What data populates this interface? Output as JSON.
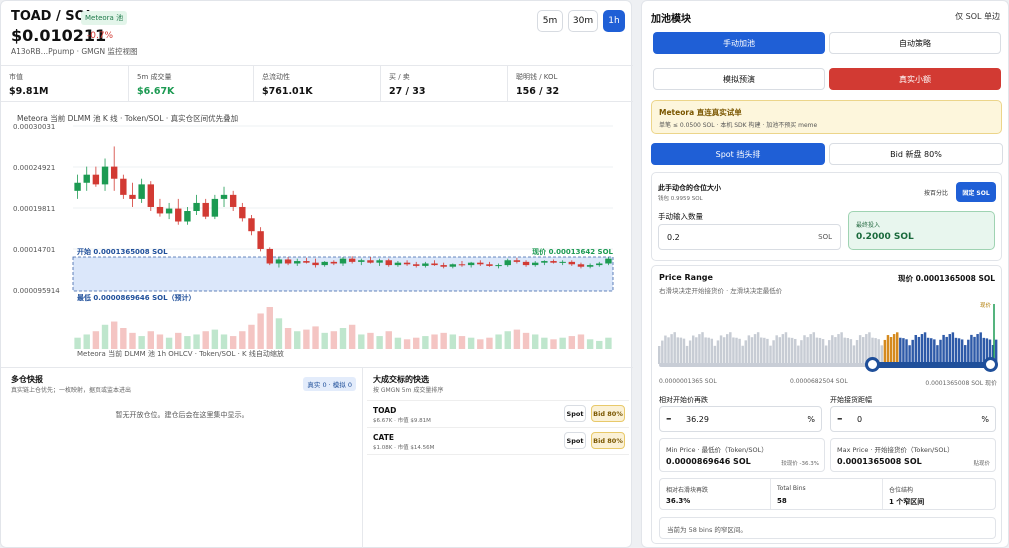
{
  "header": {
    "symbol": "TOAD / SOL",
    "badge": "Meteora 池",
    "price": "$0.010211",
    "change": "-0.7%",
    "address": "A13oRB…Ppump · GMGN 监控视图"
  },
  "timeframes": [
    "5m",
    "30m",
    "1h"
  ],
  "stats": [
    {
      "label": "市值",
      "value": "$9.81M"
    },
    {
      "label": "5m 成交量",
      "value": "$6.67K"
    },
    {
      "label": "总流动性",
      "value": "$761.01K"
    },
    {
      "label": "买 / 卖",
      "value": "27 / 33"
    },
    {
      "label": "聪明钱 / KOL",
      "value": "156 / 32"
    }
  ],
  "chart": {
    "title": "Meteora 当前 DLMM 池 K 线 · Token/SOL · 真实仓区间优先叠加",
    "yticks": [
      "0.00030031",
      "0.00024921",
      "0.00019811",
      "0.00014701",
      "0.000095914"
    ],
    "start_label": "开始 0.0001365008 SOL",
    "current_label": "现价 0.00013642 SOL",
    "lowest_label": "最低 0.0000869646 SOL（预计）",
    "volume_label": "Meteora 当前 DLMM 池 1h OHLCV · Token/SOL · K 线自动缩放"
  },
  "chart_data": {
    "type": "candlestick",
    "title": "Meteora 当前 DLMM 池 K 线 · Token/SOL · 真实仓区间优先叠加",
    "y_range": [
      9.5914e-05,
      0.00030031
    ],
    "range_band": {
      "high": 0.0001365008,
      "low": 8.69646e-05
    },
    "candles": [
      {
        "o": 0.00022,
        "h": 0.00024,
        "l": 0.00021,
        "c": 0.00023,
        "v": 14
      },
      {
        "o": 0.00023,
        "h": 0.00025,
        "l": 0.00022,
        "c": 0.00024,
        "v": 18
      },
      {
        "o": 0.00024,
        "h": 0.00025,
        "l": 0.000225,
        "c": 0.000228,
        "v": 22
      },
      {
        "o": 0.000228,
        "h": 0.00026,
        "l": 0.00022,
        "c": 0.00025,
        "v": 30
      },
      {
        "o": 0.00025,
        "h": 0.000275,
        "l": 0.00022,
        "c": 0.000235,
        "v": 34
      },
      {
        "o": 0.000235,
        "h": 0.00024,
        "l": 0.00021,
        "c": 0.000215,
        "v": 26
      },
      {
        "o": 0.000215,
        "h": 0.00023,
        "l": 0.0002,
        "c": 0.00021,
        "v": 20
      },
      {
        "o": 0.00021,
        "h": 0.000235,
        "l": 0.000205,
        "c": 0.000228,
        "v": 16
      },
      {
        "o": 0.000228,
        "h": 0.000232,
        "l": 0.000195,
        "c": 0.0002,
        "v": 22
      },
      {
        "o": 0.0002,
        "h": 0.00021,
        "l": 0.000188,
        "c": 0.000192,
        "v": 18
      },
      {
        "o": 0.000192,
        "h": 0.000205,
        "l": 0.000185,
        "c": 0.000198,
        "v": 14
      },
      {
        "o": 0.000198,
        "h": 0.00021,
        "l": 0.000178,
        "c": 0.000182,
        "v": 20
      },
      {
        "o": 0.000182,
        "h": 0.0002,
        "l": 0.000178,
        "c": 0.000195,
        "v": 16
      },
      {
        "o": 0.000195,
        "h": 0.000215,
        "l": 0.00019,
        "c": 0.000205,
        "v": 18
      },
      {
        "o": 0.000205,
        "h": 0.00021,
        "l": 0.000185,
        "c": 0.000188,
        "v": 22
      },
      {
        "o": 0.000188,
        "h": 0.000215,
        "l": 0.000185,
        "c": 0.00021,
        "v": 24
      },
      {
        "o": 0.00021,
        "h": 0.000225,
        "l": 0.0002,
        "c": 0.000215,
        "v": 18
      },
      {
        "o": 0.000215,
        "h": 0.00022,
        "l": 0.000195,
        "c": 0.0002,
        "v": 16
      },
      {
        "o": 0.0002,
        "h": 0.000205,
        "l": 0.000182,
        "c": 0.000186,
        "v": 22
      },
      {
        "o": 0.000186,
        "h": 0.00019,
        "l": 0.000165,
        "c": 0.00017,
        "v": 30
      },
      {
        "o": 0.00017,
        "h": 0.000175,
        "l": 0.000145,
        "c": 0.000148,
        "v": 44
      },
      {
        "o": 0.000148,
        "h": 0.00015,
        "l": 0.000128,
        "c": 0.00013,
        "v": 52
      },
      {
        "o": 0.00013,
        "h": 0.000138,
        "l": 0.000125,
        "c": 0.000135,
        "v": 38
      },
      {
        "o": 0.000135,
        "h": 0.000138,
        "l": 0.000128,
        "c": 0.00013,
        "v": 26
      },
      {
        "o": 0.00013,
        "h": 0.000136,
        "l": 0.000127,
        "c": 0.000133,
        "v": 22
      },
      {
        "o": 0.000133,
        "h": 0.000137,
        "l": 0.00013,
        "c": 0.000131,
        "v": 24
      },
      {
        "o": 0.000131,
        "h": 0.000136,
        "l": 0.000125,
        "c": 0.000128,
        "v": 28
      },
      {
        "o": 0.000128,
        "h": 0.000133,
        "l": 0.000126,
        "c": 0.000132,
        "v": 20
      },
      {
        "o": 0.000132,
        "h": 0.000134,
        "l": 0.000128,
        "c": 0.00013,
        "v": 22
      },
      {
        "o": 0.00013,
        "h": 0.000138,
        "l": 0.000127,
        "c": 0.000136,
        "v": 26
      },
      {
        "o": 0.000136,
        "h": 0.000139,
        "l": 0.00013,
        "c": 0.000132,
        "v": 30
      },
      {
        "o": 0.000132,
        "h": 0.000136,
        "l": 0.000128,
        "c": 0.000134,
        "v": 18
      },
      {
        "o": 0.000134,
        "h": 0.000138,
        "l": 0.00013,
        "c": 0.000131,
        "v": 20
      },
      {
        "o": 0.000131,
        "h": 0.000136,
        "l": 0.000127,
        "c": 0.000134,
        "v": 16
      },
      {
        "o": 0.000134,
        "h": 0.000136,
        "l": 0.000126,
        "c": 0.000128,
        "v": 22
      },
      {
        "o": 0.000128,
        "h": 0.000133,
        "l": 0.000126,
        "c": 0.000131,
        "v": 14
      },
      {
        "o": 0.000131,
        "h": 0.000134,
        "l": 0.000127,
        "c": 0.000129,
        "v": 12
      },
      {
        "o": 0.000129,
        "h": 0.000132,
        "l": 0.000125,
        "c": 0.000127,
        "v": 14
      },
      {
        "o": 0.000127,
        "h": 0.000132,
        "l": 0.000125,
        "c": 0.00013,
        "v": 16
      },
      {
        "o": 0.00013,
        "h": 0.000134,
        "l": 0.000127,
        "c": 0.000128,
        "v": 18
      },
      {
        "o": 0.000128,
        "h": 0.000131,
        "l": 0.000124,
        "c": 0.000126,
        "v": 20
      },
      {
        "o": 0.000126,
        "h": 0.00013,
        "l": 0.000124,
        "c": 0.000129,
        "v": 18
      },
      {
        "o": 0.000129,
        "h": 0.000133,
        "l": 0.000126,
        "c": 0.000128,
        "v": 16
      },
      {
        "o": 0.000128,
        "h": 0.000132,
        "l": 0.000125,
        "c": 0.000131,
        "v": 14
      },
      {
        "o": 0.000131,
        "h": 0.000134,
        "l": 0.000127,
        "c": 0.000129,
        "v": 12
      },
      {
        "o": 0.000129,
        "h": 0.000132,
        "l": 0.000126,
        "c": 0.000127,
        "v": 14
      },
      {
        "o": 0.000127,
        "h": 0.00013,
        "l": 0.000124,
        "c": 0.000128,
        "v": 18
      },
      {
        "o": 0.000128,
        "h": 0.000136,
        "l": 0.000126,
        "c": 0.000134,
        "v": 22
      },
      {
        "o": 0.000134,
        "h": 0.000137,
        "l": 0.00013,
        "c": 0.000132,
        "v": 24
      },
      {
        "o": 0.000132,
        "h": 0.000134,
        "l": 0.000126,
        "c": 0.000128,
        "v": 20
      },
      {
        "o": 0.000128,
        "h": 0.000133,
        "l": 0.000126,
        "c": 0.000131,
        "v": 18
      },
      {
        "o": 0.000131,
        "h": 0.000134,
        "l": 0.000128,
        "c": 0.000133,
        "v": 14
      },
      {
        "o": 0.000133,
        "h": 0.000135,
        "l": 0.00013,
        "c": 0.000131,
        "v": 12
      },
      {
        "o": 0.000131,
        "h": 0.000134,
        "l": 0.000128,
        "c": 0.000132,
        "v": 14
      },
      {
        "o": 0.000132,
        "h": 0.000134,
        "l": 0.000127,
        "c": 0.000129,
        "v": 16
      },
      {
        "o": 0.000129,
        "h": 0.000131,
        "l": 0.000124,
        "c": 0.000126,
        "v": 18
      },
      {
        "o": 0.000126,
        "h": 0.00013,
        "l": 0.000124,
        "c": 0.000128,
        "v": 12
      },
      {
        "o": 0.000128,
        "h": 0.000132,
        "l": 0.000126,
        "c": 0.00013,
        "v": 10
      },
      {
        "o": 0.00013,
        "h": 0.000138,
        "l": 0.000128,
        "c": 0.000136,
        "v": 14
      }
    ]
  },
  "multi_snapshot": {
    "title": "多仓快报",
    "subtitle": "真实链上仓优先；一枚映射，据页或监本进出",
    "tag": "真实 0 · 模拟 0",
    "empty": "暂无开放仓位。建仓后会在这里集中显示。"
  },
  "big_trade": {
    "title": "大成交标的快选",
    "subtitle": "按 GMGN 5m 成交量排序",
    "items": [
      {
        "name": "TOAD",
        "detail": "$6.67K · 市值 $9.81M",
        "spot": "Spot",
        "bid": "Bid 80%"
      },
      {
        "name": "CATE",
        "detail": "$1.08K · 市值 $14.56M",
        "spot": "Spot",
        "bid": "Bid 80%"
      }
    ]
  },
  "right": {
    "title": "加池模块",
    "title_right": "仅 SOL 单边",
    "mode_manual": "手动加池",
    "mode_auto": "自动策略",
    "sim": "模拟预演",
    "real": "真实小额",
    "notice_title": "Meteora 直连真实试单",
    "notice_body": "单笔 ≤ 0.0500 SOL · 本机 SDK 构建 · 加池不预买 meme",
    "spot": "Spot 挡头排",
    "bid": "Bid 新盘 80%",
    "size_title": "此手动仓的仓位大小",
    "size_sub": "钱包 0.9959 SOL",
    "by_pct": "按百分比",
    "fixed": "固定 SOL",
    "input_label": "手动输入数量",
    "input_value": "0.2",
    "input_unit": "SOL",
    "final_label": "最终投入",
    "final_value": "0.2000 SOL",
    "pr_title": "Price Range",
    "pr_desc": "右滑块决定开始接货价 · 左滑块决定最低价",
    "pr_cur": "现价 0.0001365008 SOL",
    "pr_now": "现价",
    "axis_left": "0.0000001365 SOL",
    "axis_mid": "0.0000682504 SOL",
    "axis_right": "0.0001365008 SOL 现价",
    "rel_label": "相对开始价再跌",
    "rel_value": "36.29",
    "rel_unit": "%",
    "start_label": "开始接货距幅",
    "start_value": "0",
    "start_unit": "%",
    "min_title": "Min Price · 最低价（Token/SOL）",
    "min_value": "0.0000869646 SOL",
    "min_note": "较现价 -36.3%",
    "max_title": "Max Price · 开始接货价（Token/SOL）",
    "max_value": "0.0001365008 SOL",
    "max_note": "贴现价",
    "c1_l": "相对右滑块再跌",
    "c1_v": "36.3%",
    "c2_l": "Total Bins",
    "c2_v": "58",
    "c3_l": "仓位结构",
    "c3_v": "1 个窄区间",
    "footer": "当前为 58 bins 的窄区间。"
  }
}
